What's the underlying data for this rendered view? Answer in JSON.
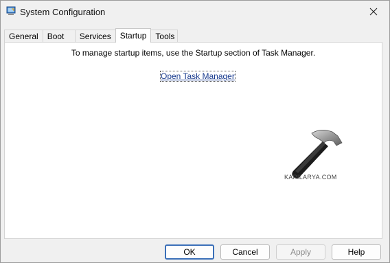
{
  "window": {
    "title": "System Configuration",
    "app_icon": "msconfig-icon",
    "close_icon": "close-icon"
  },
  "tabs": [
    {
      "label": "General",
      "active": false
    },
    {
      "label": "Boot",
      "active": false
    },
    {
      "label": "Services",
      "active": false
    },
    {
      "label": "Startup",
      "active": true
    },
    {
      "label": "Tools",
      "active": false
    }
  ],
  "startup_panel": {
    "message": "To manage startup items, use the Startup section of Task Manager.",
    "link_label": "Open Task Manager"
  },
  "watermark": {
    "text": "KAPILARYA.COM",
    "icon": "hammer-logo"
  },
  "buttons": {
    "ok": "OK",
    "cancel": "Cancel",
    "apply": "Apply",
    "help": "Help"
  },
  "colors": {
    "window_bg": "#f0f0f0",
    "panel_bg": "#ffffff",
    "link": "#1a3c8f",
    "default_button_border": "#3a6fb8"
  }
}
